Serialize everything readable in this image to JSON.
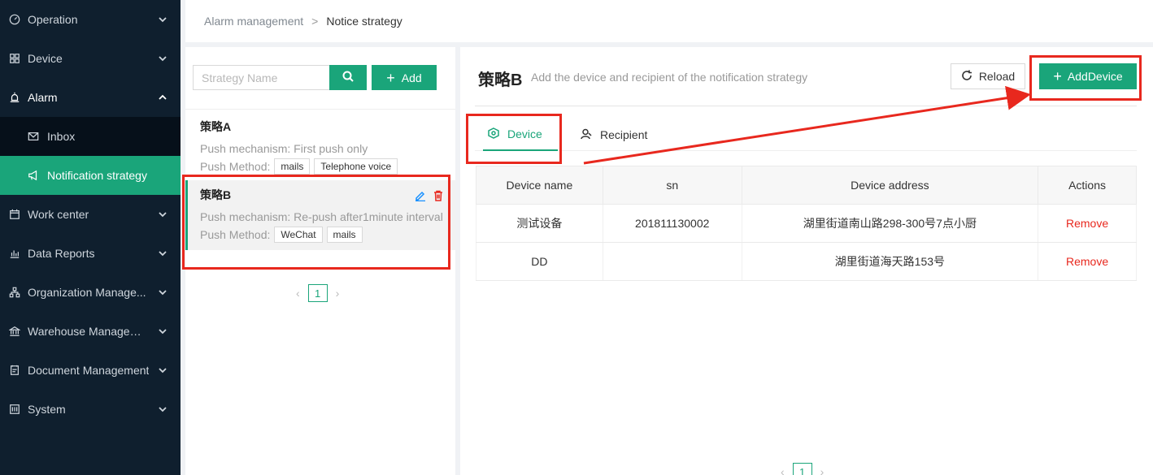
{
  "sidebar": {
    "items": [
      {
        "label": "Operation",
        "icon": "dashboard-icon"
      },
      {
        "label": "Device",
        "icon": "grid-icon"
      },
      {
        "label": "Alarm",
        "icon": "alarm-icon",
        "expanded": true,
        "children": [
          {
            "label": "Inbox",
            "icon": "mail-icon"
          },
          {
            "label": "Notification strategy",
            "icon": "megaphone-icon",
            "active": true
          }
        ]
      },
      {
        "label": "Work center",
        "icon": "calendar-icon"
      },
      {
        "label": "Data Reports",
        "icon": "bar-chart-icon"
      },
      {
        "label": "Organization Manage...",
        "icon": "org-icon"
      },
      {
        "label": "Warehouse Manageme...",
        "icon": "bank-icon"
      },
      {
        "label": "Document Management",
        "icon": "document-icon"
      },
      {
        "label": "System",
        "icon": "settings-icon"
      }
    ]
  },
  "breadcrumb": {
    "parent": "Alarm management",
    "separator": ">",
    "current": "Notice strategy"
  },
  "left": {
    "search_placeholder": "Strategy Name",
    "add_label": "Add",
    "strategies": [
      {
        "name": "策略A",
        "mechanism": "Push mechanism: First push only",
        "method_label": "Push Method:",
        "methods": [
          "mails",
          "Telephone voice"
        ]
      },
      {
        "name": "策略B",
        "mechanism": "Push mechanism: Re-push after1minute interval",
        "method_label": "Push Method:",
        "methods": [
          "WeChat",
          "mails"
        ]
      }
    ],
    "page": "1"
  },
  "right": {
    "title": "策略B",
    "subtitle": "Add the device and recipient of the notification strategy",
    "reload_label": "Reload",
    "add_device_label": "AddDevice",
    "tabs": [
      {
        "label": "Device",
        "active": true
      },
      {
        "label": "Recipient"
      }
    ],
    "columns": [
      "Device name",
      "sn",
      "Device address",
      "Actions"
    ],
    "rows": [
      {
        "name": "测试设备",
        "sn": "201811130002",
        "address": "湖里街道南山路298-300号7点小厨",
        "action": "Remove"
      },
      {
        "name": "DD",
        "sn": "",
        "address": "湖里街道海天路153号",
        "action": "Remove"
      }
    ],
    "page": "1"
  },
  "colors": {
    "accent": "#1aa57a",
    "sidebar_bg": "#0f1f2e",
    "annotation": "#e8281e",
    "danger": "#e8281e"
  }
}
